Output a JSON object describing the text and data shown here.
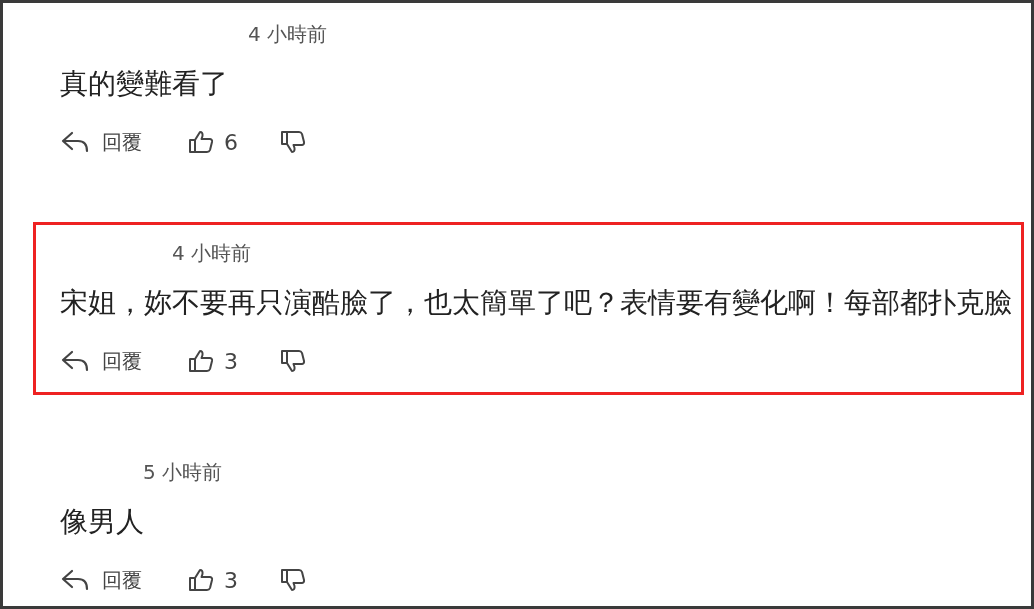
{
  "comments": [
    {
      "time": "4 小時前",
      "text": "真的變難看了",
      "reply_label": "回覆",
      "likes": "6",
      "highlighted": false
    },
    {
      "time": "4 小時前",
      "text": "宋姐，妳不要再只演酷臉了，也太簡單了吧？表情要有變化啊！每部都扑克臉",
      "reply_label": "回覆",
      "likes": "3",
      "highlighted": true
    },
    {
      "time": "5 小時前",
      "text": "像男人",
      "reply_label": "回覆",
      "likes": "3",
      "highlighted": false
    }
  ]
}
